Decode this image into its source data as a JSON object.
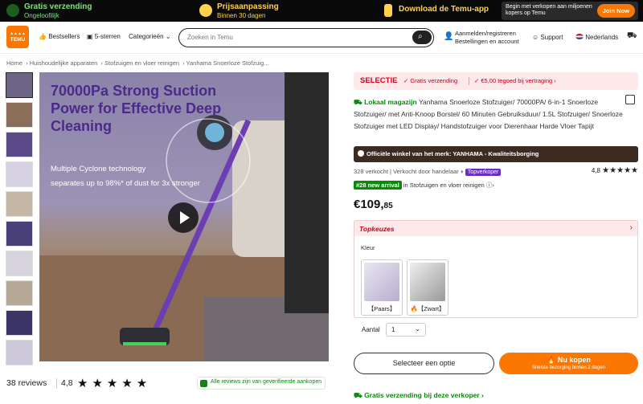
{
  "promo": {
    "free_shipping_title": "Gratis verzending",
    "free_shipping_sub": "Ongeloofilijk",
    "price_adjust_title": "Prijsaanpassing",
    "price_adjust_sub": "Binnen 30 dagen",
    "app_download": "Download de Temu-app",
    "seller_text": "Begin met verkopen aan miljoenen kopers op Temu",
    "join_now": "Join Now",
    "accent_color": "#fb7701",
    "green_color": "#7ee27e",
    "yellow_color": "#ffd24d"
  },
  "header": {
    "logo_text": "TEMU",
    "nav": [
      "Bestsellers",
      "5-sterren",
      "Categorieën"
    ],
    "search_placeholder": "Zoeken in Temu",
    "account_line1": "Aanmelden/registreren",
    "account_line2": "Bestellingen en account",
    "support": "Support",
    "language": "Nederlands"
  },
  "breadcrumb": [
    "Home",
    "Huishoudelijke apparaten",
    "Stofzuigen en vloer reinigen",
    "Yanhama Snoerloze Stofzuig..."
  ],
  "main_image": {
    "headline": "70000Pa Strong Suction Power for Effective Deep Cleaning",
    "sub1": "Multiple Cyclone technology",
    "sub2": "separates up to 98%* of dust for 3x stronger"
  },
  "reviews": {
    "count": "38 reviews",
    "rating": "4,8",
    "stars": "★★★★★",
    "verified": "Alle reviews zijn van geverifieerde aankopen"
  },
  "product": {
    "selectie": "SELECTIE",
    "selectie_free": "✓ Gratis verzending",
    "selectie_credit": "✓ €5,00 tegoed bij vertraging ›",
    "local_warehouse": "Lokaal magazijn",
    "title": "Yanhama Snoerloze Stofzuiger/ 70000PA/ 6-in-1 Snoerloze Stofzuiger/ met Anti-Knoop Borstel/ 60 Minuten Gebruiksduur/ 1.5L Stofzuiger/ Snoerloze Stofzuiger met LED Display/ Handstofzuiger voor Dierenhaar Harde Vloer Tapijt",
    "official_store": "Officiële winkel van het merk: YANHAMA - Kwaliteitsborging",
    "sold": "328 verkocht",
    "sold_by": "Verkocht door handelaar",
    "top_seller": "Topverkoper",
    "rating": "4,8",
    "stars": "★★★★★",
    "rank_badge": "#28 new arrival",
    "rank_text": "in Stofzuigen en vloer reinigen",
    "price_main": "€109,",
    "price_cents": "85",
    "top_picks": "Topkeuzes",
    "color_label": "Kleur",
    "options": [
      "【Paars】",
      "🔥【Zwart】"
    ],
    "quantity_label": "Aantal",
    "quantity_value": "1",
    "select_option": "Selecteer een optie",
    "buy_now": "🔥 Nu kopen",
    "buy_now_sub": "Snelste bezorging binnen 2 dagen",
    "free_shipping_seller": "Gratis verzending bij deze verkoper ›"
  }
}
